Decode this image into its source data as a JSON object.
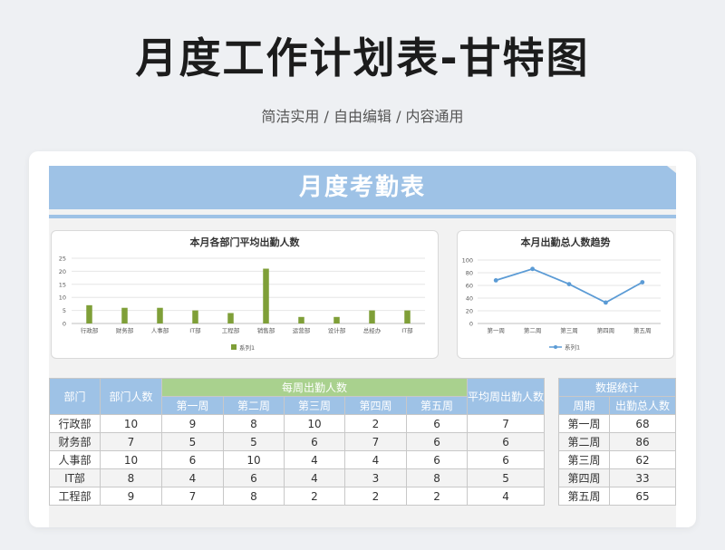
{
  "page": {
    "title": "月度工作计划表-甘特图",
    "subtitle": "简洁实用 / 自由编辑 / 内容通用"
  },
  "sheet": {
    "banner": "月度考勤表"
  },
  "colors": {
    "header_blue": "#9ec2e6",
    "header_green": "#a9d18e",
    "bar_green": "#7f9f38",
    "line_blue": "#5b9bd5"
  },
  "chart_data": [
    {
      "type": "bar",
      "title": "本月各部门平均出勤人数",
      "categories": [
        "行政部",
        "财务部",
        "人事部",
        "IT部",
        "工程部",
        "销售部",
        "运营部",
        "设计部",
        "总经办",
        "IT部"
      ],
      "series": [
        {
          "name": "系列1",
          "values": [
            7,
            6,
            6,
            5,
            4,
            21,
            2.5,
            2.5,
            5,
            5
          ]
        }
      ],
      "ylim": [
        0,
        25
      ],
      "yticks": [
        0,
        5,
        10,
        15,
        20,
        25
      ],
      "grid": true,
      "legend": "bottom"
    },
    {
      "type": "line",
      "title": "本月出勤总人数趋势",
      "categories": [
        "第一周",
        "第二周",
        "第三周",
        "第四周",
        "第五周"
      ],
      "series": [
        {
          "name": "系列1",
          "values": [
            68,
            86,
            62,
            33,
            65
          ]
        }
      ],
      "ylim": [
        0,
        100
      ],
      "yticks": [
        0,
        20,
        40,
        60,
        80,
        100
      ],
      "grid": true,
      "legend": "bottom"
    }
  ],
  "attendance_table": {
    "headers": {
      "dept": "部门",
      "people": "部门人数",
      "weekly": "每周出勤人数",
      "avg": "平均周出勤人数",
      "weeks": [
        "第一周",
        "第二周",
        "第三周",
        "第四周",
        "第五周"
      ]
    },
    "rows": [
      {
        "dept": "行政部",
        "people": "10",
        "w": [
          "9",
          "8",
          "10",
          "2",
          "6"
        ],
        "avg": "7"
      },
      {
        "dept": "财务部",
        "people": "7",
        "w": [
          "5",
          "5",
          "6",
          "7",
          "6"
        ],
        "avg": "6"
      },
      {
        "dept": "人事部",
        "people": "10",
        "w": [
          "6",
          "10",
          "4",
          "4",
          "6"
        ],
        "avg": "6"
      },
      {
        "dept": "IT部",
        "people": "8",
        "w": [
          "4",
          "6",
          "4",
          "3",
          "8"
        ],
        "avg": "5"
      },
      {
        "dept": "工程部",
        "people": "9",
        "w": [
          "7",
          "8",
          "2",
          "2",
          "2"
        ],
        "avg": "4"
      }
    ]
  },
  "stats_table": {
    "title": "数据统计",
    "headers": {
      "week": "周期",
      "total": "出勤总人数"
    },
    "rows": [
      {
        "week": "第一周",
        "total": "68"
      },
      {
        "week": "第二周",
        "total": "86"
      },
      {
        "week": "第三周",
        "total": "62"
      },
      {
        "week": "第四周",
        "total": "33"
      },
      {
        "week": "第五周",
        "total": "65"
      }
    ]
  }
}
